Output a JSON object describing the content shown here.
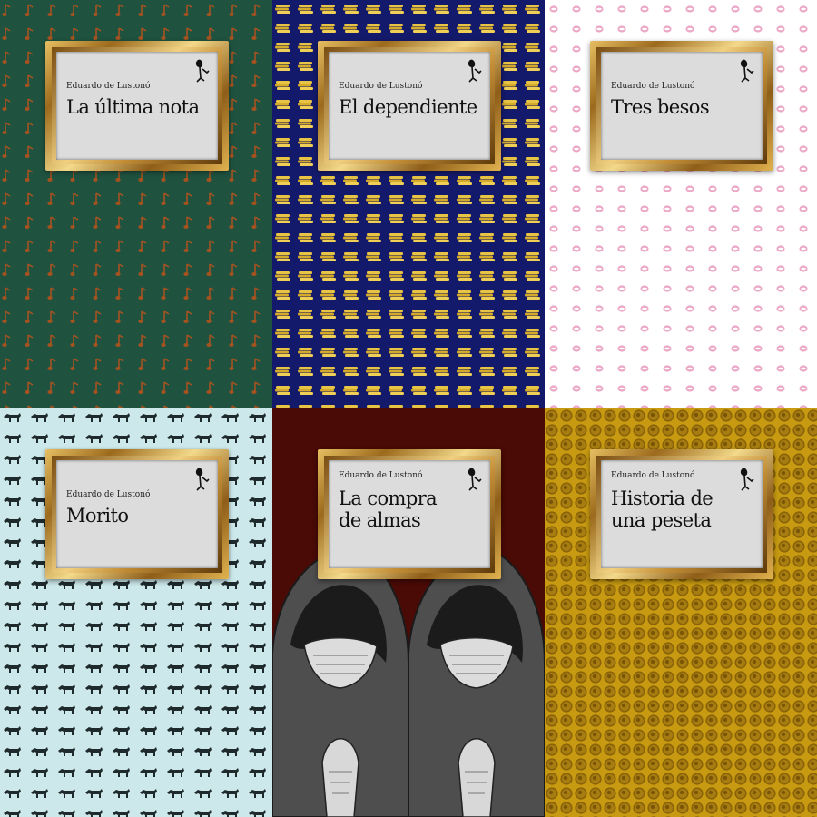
{
  "covers": [
    {
      "author": "Eduardo de Lustonó",
      "title": "La última nota",
      "pattern_icon": "musical-note-icon",
      "background": "#1f5340",
      "motif_color": "#a5521f"
    },
    {
      "author": "Eduardo de Lustonó",
      "title": "El dependiente",
      "pattern_icon": "coin-stack-icon",
      "background": "#141a6b",
      "motif_color": "#e3c042"
    },
    {
      "author": "Eduardo de Lustonó",
      "title": "Tres besos",
      "pattern_icon": "lips-icon",
      "background": "#ffffff",
      "motif_color": "#e9a8c6"
    },
    {
      "author": "Eduardo de Lustonó",
      "title": "Morito",
      "pattern_icon": "dog-icon",
      "background": "#cde8ea",
      "motif_color": "#1e2a2c"
    },
    {
      "author": "Eduardo de Lustonó",
      "title": "La compra de almas",
      "pattern_icon": "hooded-figure-icon",
      "background": "#4a0a06",
      "motif_color": "#5b5b5b"
    },
    {
      "author": "Eduardo de Lustonó",
      "title": "Historia de una peseta",
      "pattern_icon": "peseta-coin-icon",
      "background": "#c79a12",
      "motif_color": "#8a6308"
    }
  ]
}
